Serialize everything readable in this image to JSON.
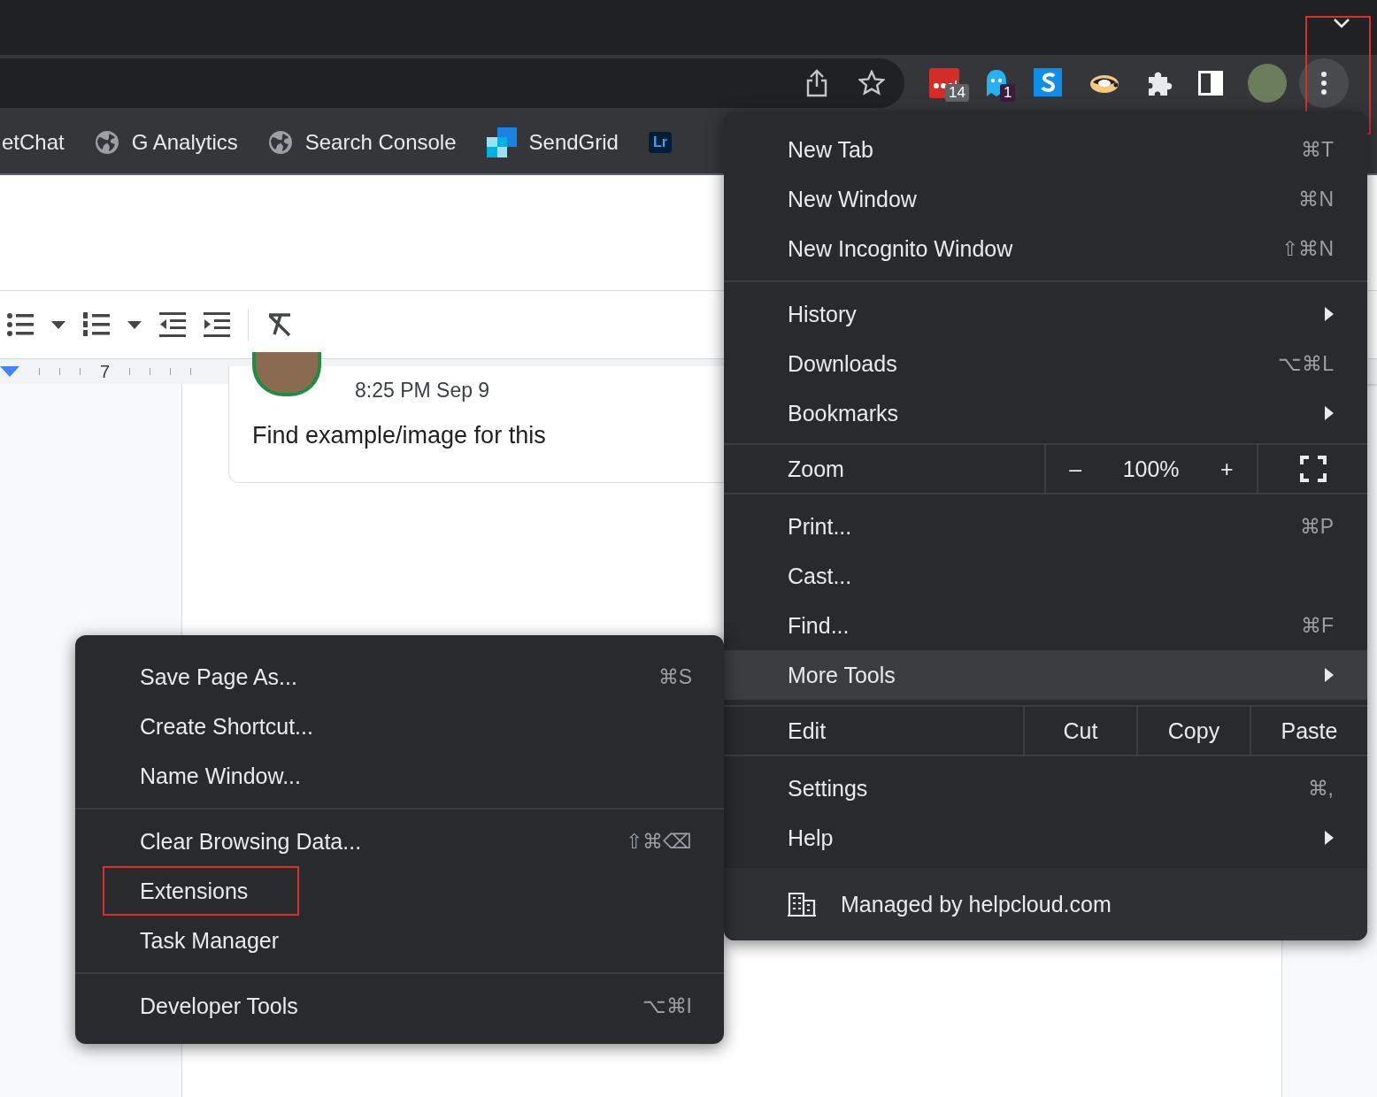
{
  "toolbar": {
    "badges": [
      "14",
      "1"
    ],
    "menu_button_highlighted": true
  },
  "bookmarks": [
    {
      "label": "etChat",
      "kind": "plain"
    },
    {
      "label": "G Analytics",
      "kind": "globe"
    },
    {
      "label": "Search Console",
      "kind": "globe"
    },
    {
      "label": "SendGrid",
      "kind": "grid"
    },
    {
      "label": "Lr",
      "kind": "tile"
    }
  ],
  "ruler": {
    "number": "7"
  },
  "comment": {
    "time": "8:25 PM Sep 9",
    "text": "Find example/image for this"
  },
  "menu": {
    "items": [
      {
        "kind": "item",
        "label": "New Tab",
        "shortcut": "⌘T",
        "submenu": false,
        "selected": false
      },
      {
        "kind": "item",
        "label": "New Window",
        "shortcut": "⌘N",
        "submenu": false,
        "selected": false
      },
      {
        "kind": "item",
        "label": "New Incognito Window",
        "shortcut": "⇧⌘N",
        "submenu": false,
        "selected": false
      },
      {
        "kind": "separator"
      },
      {
        "kind": "item",
        "label": "History",
        "submenu": true,
        "selected": false
      },
      {
        "kind": "item",
        "label": "Downloads",
        "shortcut": "⌥⌘L",
        "submenu": false,
        "selected": false
      },
      {
        "kind": "item",
        "label": "Bookmarks",
        "submenu": true,
        "selected": false
      },
      {
        "kind": "zoom",
        "label": "Zoom",
        "minus": "–",
        "value": "100%",
        "plus": "+"
      },
      {
        "kind": "item",
        "label": "Print...",
        "shortcut": "⌘P",
        "submenu": false,
        "selected": false
      },
      {
        "kind": "item",
        "label": "Cast...",
        "submenu": false,
        "selected": false
      },
      {
        "kind": "item",
        "label": "Find...",
        "shortcut": "⌘F",
        "submenu": false,
        "selected": false
      },
      {
        "kind": "item",
        "label": "More Tools",
        "submenu": true,
        "selected": true
      },
      {
        "kind": "edit",
        "label": "Edit",
        "buttons": [
          "Cut",
          "Copy",
          "Paste"
        ]
      },
      {
        "kind": "item",
        "label": "Settings",
        "shortcut": "⌘,",
        "submenu": false,
        "selected": false
      },
      {
        "kind": "item",
        "label": "Help",
        "submenu": true,
        "selected": false
      },
      {
        "kind": "managed",
        "label": "Managed by helpcloud.com"
      }
    ]
  },
  "submenu": {
    "items": [
      {
        "kind": "item",
        "label": "Save Page As...",
        "shortcut": "⌘S",
        "highlighted": false
      },
      {
        "kind": "item",
        "label": "Create Shortcut...",
        "highlighted": false
      },
      {
        "kind": "item",
        "label": "Name Window...",
        "highlighted": false
      },
      {
        "kind": "separator"
      },
      {
        "kind": "item",
        "label": "Clear Browsing Data...",
        "shortcut": "⇧⌘⌫",
        "highlighted": false
      },
      {
        "kind": "item",
        "label": "Extensions",
        "highlighted": true
      },
      {
        "kind": "item",
        "label": "Task Manager",
        "highlighted": false
      },
      {
        "kind": "separator"
      },
      {
        "kind": "item",
        "label": "Developer Tools",
        "shortcut": "⌥⌘I",
        "highlighted": false
      }
    ]
  }
}
